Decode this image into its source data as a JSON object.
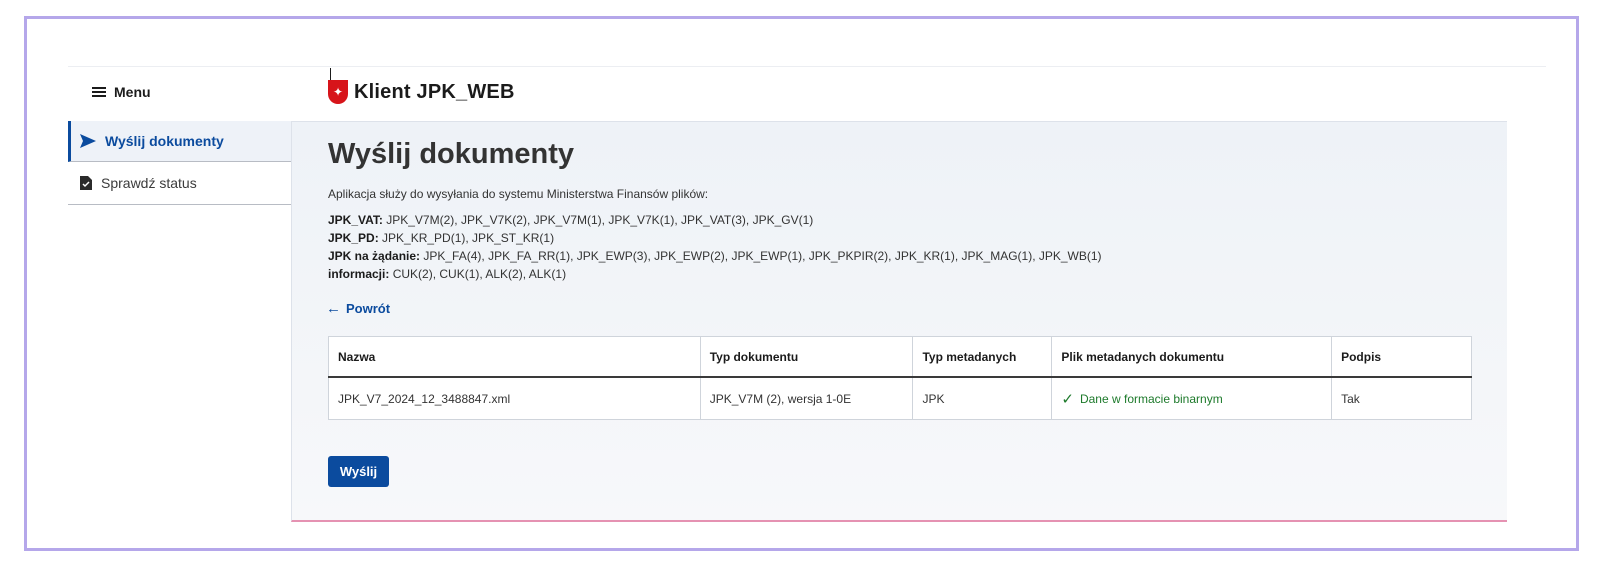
{
  "header": {
    "menu_label": "Menu",
    "app_title": "Klient JPK_WEB",
    "emblem_icon": "poland-eagle-icon"
  },
  "sidebar": {
    "items": [
      {
        "label": "Wyślij dokumenty",
        "icon": "send-icon",
        "active": true
      },
      {
        "label": "Sprawdź status",
        "icon": "document-check-icon",
        "active": false
      }
    ]
  },
  "main": {
    "title": "Wyślij dokumenty",
    "intro": "Aplikacja służy do wysyłania do systemu Ministerstwa Finansów plików:",
    "types": [
      {
        "label": "JPK_VAT:",
        "value": "JPK_V7M(2), JPK_V7K(2), JPK_V7M(1), JPK_V7K(1), JPK_VAT(3), JPK_GV(1)"
      },
      {
        "label": "JPK_PD:",
        "value": "JPK_KR_PD(1), JPK_ST_KR(1)"
      },
      {
        "label": "JPK na żądanie:",
        "value": "JPK_FA(4), JPK_FA_RR(1), JPK_EWP(3), JPK_EWP(2), JPK_EWP(1), JPK_PKPIR(2), JPK_KR(1), JPK_MAG(1), JPK_WB(1)"
      },
      {
        "label": "informacji:",
        "value": "CUK(2), CUK(1), ALK(2), ALK(1)"
      }
    ],
    "back_label": "Powrót",
    "table": {
      "headers": [
        "Nazwa",
        "Typ dokumentu",
        "Typ metadanych",
        "Plik metadanych dokumentu",
        "Podpis"
      ],
      "rows": [
        {
          "name": "JPK_V7_2024_12_3488847.xml",
          "doc_type": "JPK_V7M (2), wersja 1-0E",
          "meta_type": "JPK",
          "meta_file": "Dane w formacie binarnym",
          "signature": "Tak"
        }
      ]
    },
    "send_label": "Wyślij"
  },
  "colors": {
    "accent": "#0b4b9e",
    "success": "#1d7a2b",
    "frame": "#b5a7ea"
  }
}
